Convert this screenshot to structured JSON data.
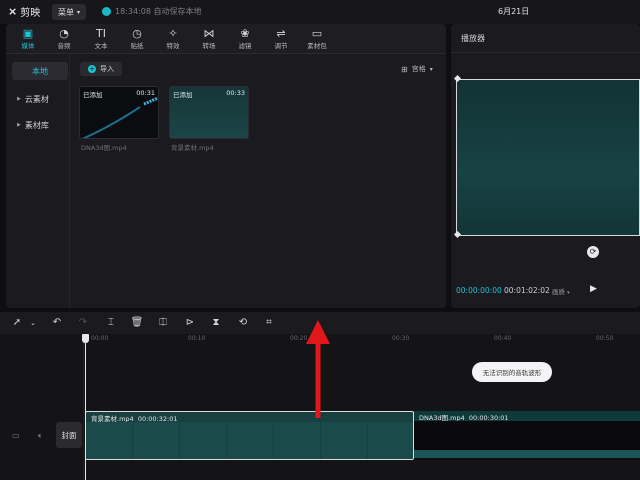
{
  "topbar": {
    "app_name": "剪映",
    "menu_label": "菜单",
    "save_status": "18:34:08 自动保存本地",
    "date": "6月21日"
  },
  "media_tabs": [
    {
      "label": "媒体",
      "icon": "media-icon",
      "active": true
    },
    {
      "label": "音频",
      "icon": "audio-icon",
      "active": false
    },
    {
      "label": "文本",
      "icon": "text-icon",
      "active": false
    },
    {
      "label": "贴纸",
      "icon": "sticker-icon",
      "active": false
    },
    {
      "label": "特效",
      "icon": "effects-icon",
      "active": false
    },
    {
      "label": "转场",
      "icon": "transition-icon",
      "active": false
    },
    {
      "label": "滤镜",
      "icon": "filter-icon",
      "active": false
    },
    {
      "label": "调节",
      "icon": "adjust-icon",
      "active": false
    },
    {
      "label": "素材包",
      "icon": "package-icon",
      "active": false
    }
  ],
  "sidebar": {
    "items": [
      {
        "label": "本地",
        "active": true
      },
      {
        "label": "云素材",
        "active": false
      },
      {
        "label": "素材库",
        "active": false
      }
    ]
  },
  "media": {
    "import_label": "导入",
    "view_label": "宫格",
    "clips": [
      {
        "name": "DNA3d图.mp4",
        "badge": "已添加",
        "duration": "00:31"
      },
      {
        "name": "背景素材.mp4",
        "badge": "已添加",
        "duration": "00:33"
      }
    ]
  },
  "player": {
    "title": "播放器",
    "current_time": "00:00:00:00",
    "total_time": "00:01:02:02",
    "quality_label": "画质"
  },
  "timeline": {
    "ruler_labels": [
      "00:00",
      "00:10",
      "00:20",
      "00:30",
      "00:40",
      "00:50"
    ],
    "audio_tip": "无法识别的音轨波形",
    "cover_label": "封面",
    "clips": [
      {
        "name": "背景素材.mp4",
        "duration": "00:00:32:01"
      },
      {
        "name": "DNA3d图.mp4",
        "duration": "00:00:30:01"
      }
    ]
  },
  "colors": {
    "accent": "#1ec3d4",
    "arrow": "#e0181b",
    "clip_teal": "#17403f"
  }
}
